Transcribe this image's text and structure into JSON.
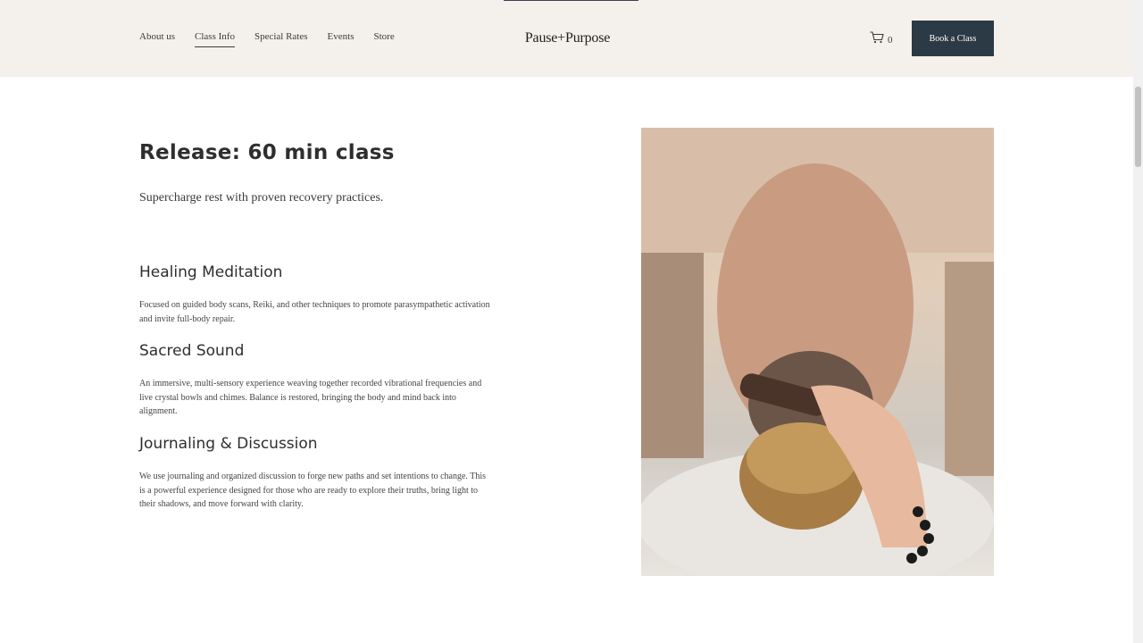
{
  "header": {
    "nav": [
      "About us",
      "Class Info",
      "Special Rates",
      "Events",
      "Store"
    ],
    "active_nav": "Class Info",
    "logo": "Pause+Purpose",
    "cart_count": "0",
    "book_label": "Book a Class"
  },
  "main": {
    "title": "Release: 60 min class",
    "subtitle": "Supercharge rest with proven recovery practices.",
    "sections": [
      {
        "heading": "Healing Meditation",
        "body": "Focused on guided body scans, Reiki, and other techniques to promote parasympathetic activation and invite full-body repair."
      },
      {
        "heading": "Sacred Sound",
        "body": "An immersive, multi-sensory experience weaving together recorded vibrational frequencies and live crystal bowls and chimes. Balance is restored, bringing the body and mind back into alignment."
      },
      {
        "heading": "Journaling & Discussion",
        "body": "We use journaling and organized discussion to forge new paths and set intentions to change. This is a powerful experience designed for those who are ready to explore their truths, bring light to their shadows, and move forward with clarity."
      }
    ]
  },
  "colors": {
    "header_bg": "#f4f1ec",
    "button_bg": "#2c3a45",
    "text": "#2e2e2e"
  },
  "icons": {
    "cart": "cart-icon"
  }
}
